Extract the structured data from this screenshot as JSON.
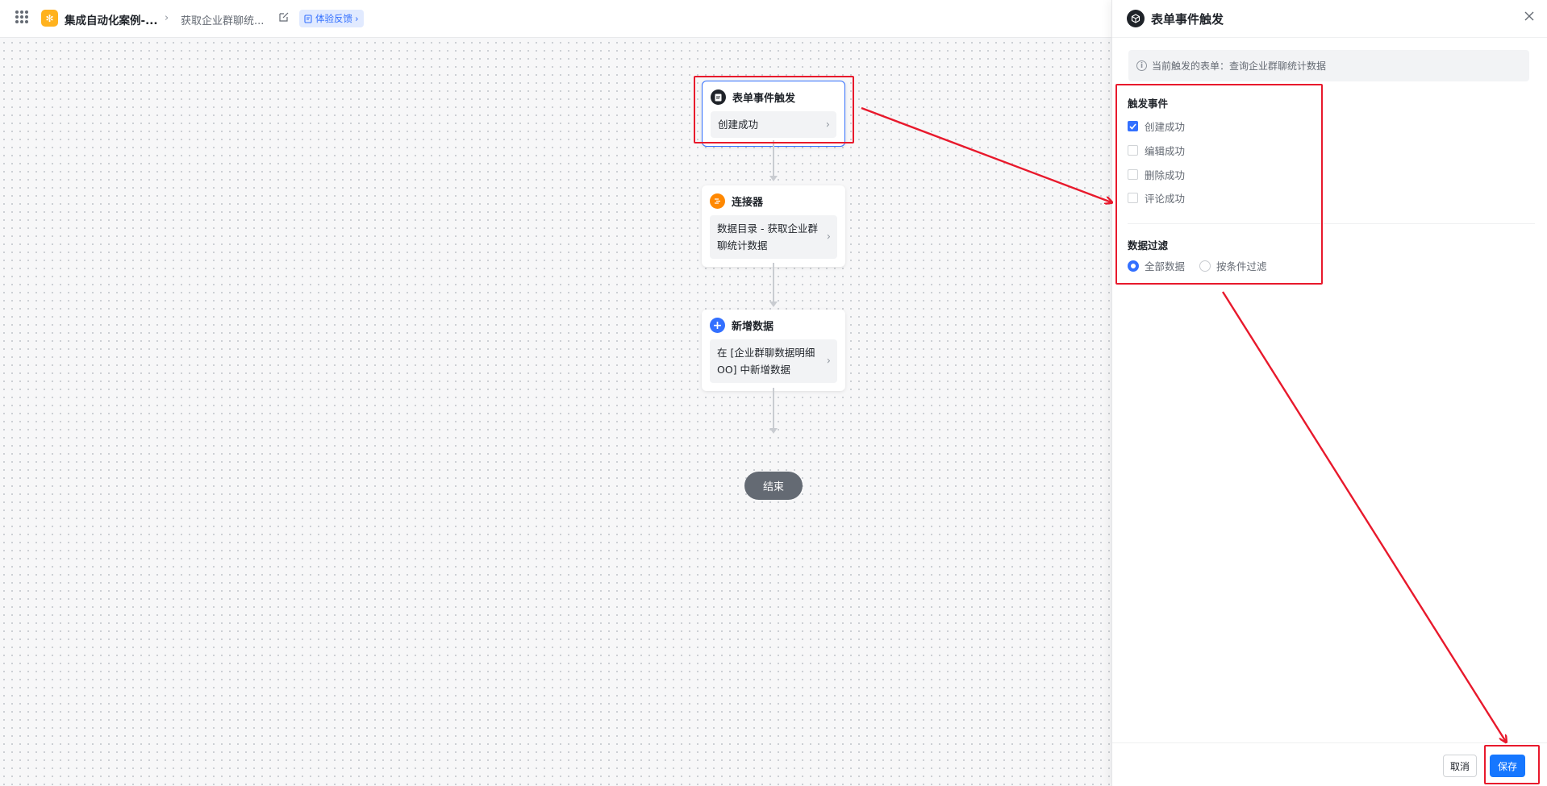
{
  "topbar": {
    "app_name": "集成自动化案例-...",
    "flow_name": "获取企业群聊统...",
    "feedback_label": "体验反馈",
    "logo_glyph": "✻"
  },
  "canvas": {
    "nodes": [
      {
        "title": "表单事件触发",
        "body": "创建成功",
        "icon": "form-icon",
        "icon_color": "#1f2329"
      },
      {
        "title": "连接器",
        "body": "数据目录 - 获取企业群聊统计数据",
        "icon": "connector-icon",
        "icon_color": "#ff8800"
      },
      {
        "title": "新增数据",
        "body": "在 [企业群聊数据明细OO] 中新增数据",
        "icon": "plus-icon",
        "icon_color": "#3370ff"
      }
    ],
    "end_label": "结束"
  },
  "panel": {
    "title": "表单事件触发",
    "info_text": "当前触发的表单：查询企业群聊统计数据",
    "trigger_section_title": "触发事件",
    "trigger_events": [
      {
        "label": "创建成功",
        "checked": true
      },
      {
        "label": "编辑成功",
        "checked": false
      },
      {
        "label": "删除成功",
        "checked": false
      },
      {
        "label": "评论成功",
        "checked": false
      }
    ],
    "filter_section_title": "数据过滤",
    "filter_options": [
      {
        "label": "全部数据",
        "selected": true
      },
      {
        "label": "按条件过滤",
        "selected": false
      }
    ],
    "cancel_label": "取消",
    "save_label": "保存"
  },
  "colors": {
    "accent": "#3370ff",
    "annotation": "#e8192c",
    "save_button": "#1677ff"
  }
}
